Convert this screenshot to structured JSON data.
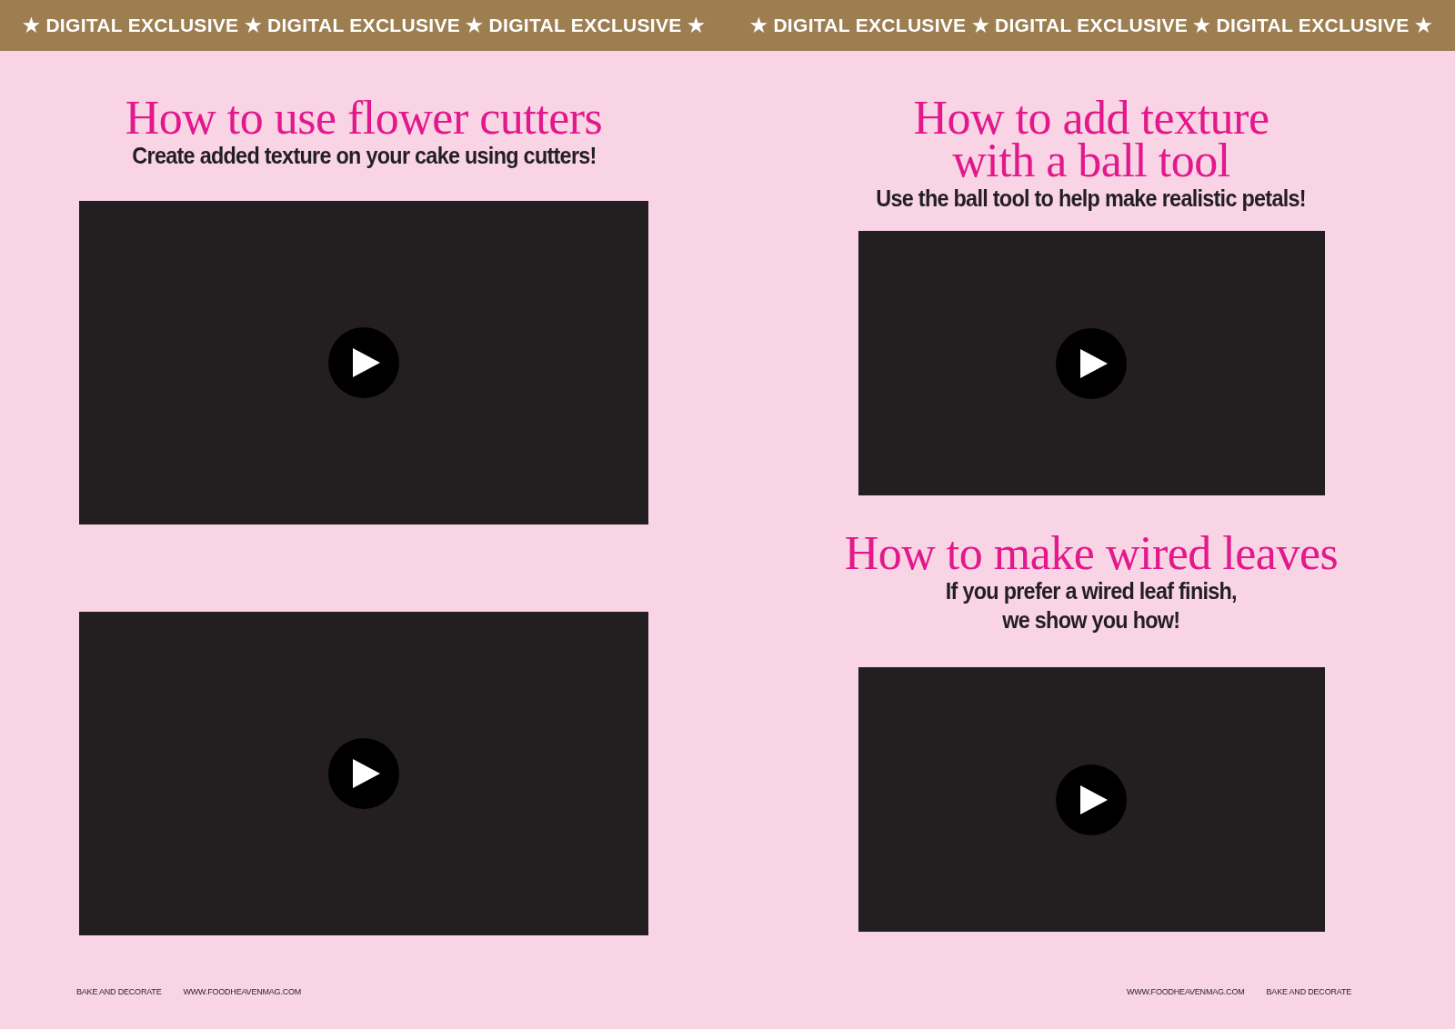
{
  "banner": {
    "halves": [
      "★ DIGITAL EXCLUSIVE ★ DIGITAL EXCLUSIVE ★ DIGITAL EXCLUSIVE ★",
      "★ DIGITAL EXCLUSIVE ★ DIGITAL EXCLUSIVE ★ DIGITAL EXCLUSIVE ★"
    ]
  },
  "pages": [
    {
      "items": [
        {
          "kind": "heading",
          "title": "How to use flower cutters",
          "subtitle": "Create added texture on your cake using cutters!"
        },
        {
          "kind": "video"
        },
        {
          "kind": "video"
        }
      ],
      "footer": [
        "BAKE AND DECORATE",
        "WWW.FOODHEAVENMAG.COM"
      ]
    },
    {
      "items": [
        {
          "kind": "heading",
          "title": "How to add texture\nwith a ball tool",
          "subtitle": "Use the ball tool to help make realistic petals!"
        },
        {
          "kind": "video"
        },
        {
          "kind": "heading",
          "title": "How to make wired leaves",
          "subtitle": "If you prefer a wired leaf finish,\nwe show you how!"
        },
        {
          "kind": "video"
        }
      ],
      "footer": [
        "WWW.FOODHEAVENMAG.COM",
        "BAKE AND DECORATE"
      ]
    }
  ]
}
